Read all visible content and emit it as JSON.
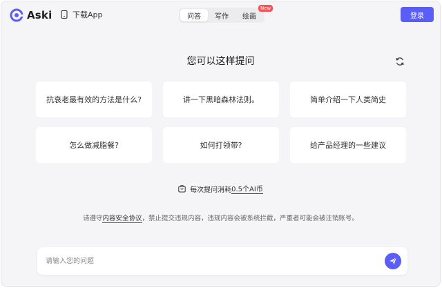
{
  "header": {
    "brand": "Aski",
    "download_label": "下载App",
    "tabs": [
      {
        "label": "问答",
        "active": true
      },
      {
        "label": "写作",
        "active": false
      },
      {
        "label": "绘画",
        "active": false
      }
    ],
    "new_badge": "New",
    "login_label": "登录"
  },
  "main": {
    "heading": "您可以这样提问",
    "suggestions": [
      "抗衰老最有效的方法是什么?",
      "讲一下黑暗森林法则。",
      "简单介绍一下人类简史",
      "怎么做减脂餐?",
      "如何打领带?",
      "给产品经理的一些建议"
    ],
    "cost": {
      "prefix": "每次提问消耗 ",
      "amount": "0.5个AI币"
    },
    "notice": {
      "before": "请遵守",
      "link": "内容安全协议",
      "after": "，禁止提交违规内容，违规内容会被系统拦截，严重者可能会被注销账号。"
    }
  },
  "composer": {
    "placeholder": "请输入您的问题"
  },
  "colors": {
    "accent": "#5b5ef5",
    "badge": "#f25555",
    "background": "#f5f5f7"
  },
  "icons": [
    "logo-mark-icon",
    "phone-icon",
    "refresh-icon",
    "wallet-icon",
    "send-icon"
  ]
}
